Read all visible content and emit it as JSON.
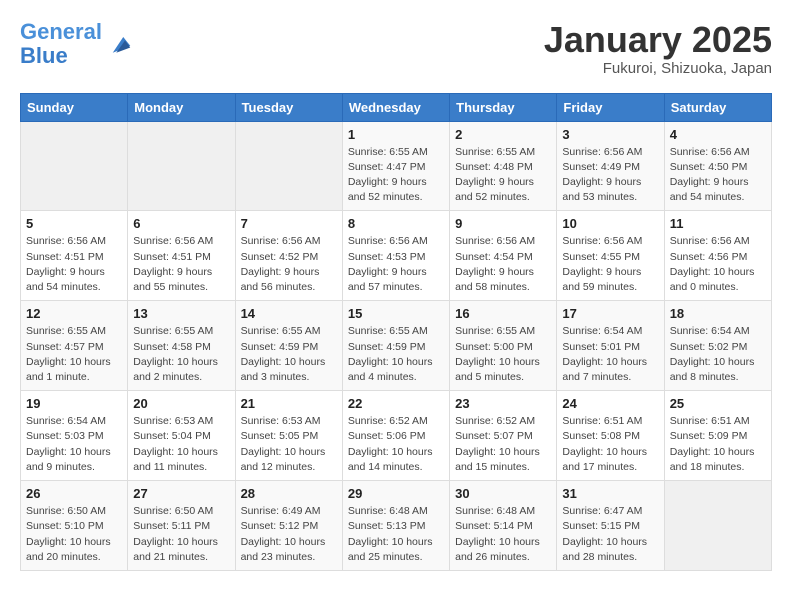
{
  "header": {
    "logo_line1": "General",
    "logo_line2": "Blue",
    "month": "January 2025",
    "location": "Fukuroi, Shizuoka, Japan"
  },
  "weekdays": [
    "Sunday",
    "Monday",
    "Tuesday",
    "Wednesday",
    "Thursday",
    "Friday",
    "Saturday"
  ],
  "weeks": [
    [
      {
        "day": "",
        "info": ""
      },
      {
        "day": "",
        "info": ""
      },
      {
        "day": "",
        "info": ""
      },
      {
        "day": "1",
        "info": "Sunrise: 6:55 AM\nSunset: 4:47 PM\nDaylight: 9 hours and 52 minutes."
      },
      {
        "day": "2",
        "info": "Sunrise: 6:55 AM\nSunset: 4:48 PM\nDaylight: 9 hours and 52 minutes."
      },
      {
        "day": "3",
        "info": "Sunrise: 6:56 AM\nSunset: 4:49 PM\nDaylight: 9 hours and 53 minutes."
      },
      {
        "day": "4",
        "info": "Sunrise: 6:56 AM\nSunset: 4:50 PM\nDaylight: 9 hours and 54 minutes."
      }
    ],
    [
      {
        "day": "5",
        "info": "Sunrise: 6:56 AM\nSunset: 4:51 PM\nDaylight: 9 hours and 54 minutes."
      },
      {
        "day": "6",
        "info": "Sunrise: 6:56 AM\nSunset: 4:51 PM\nDaylight: 9 hours and 55 minutes."
      },
      {
        "day": "7",
        "info": "Sunrise: 6:56 AM\nSunset: 4:52 PM\nDaylight: 9 hours and 56 minutes."
      },
      {
        "day": "8",
        "info": "Sunrise: 6:56 AM\nSunset: 4:53 PM\nDaylight: 9 hours and 57 minutes."
      },
      {
        "day": "9",
        "info": "Sunrise: 6:56 AM\nSunset: 4:54 PM\nDaylight: 9 hours and 58 minutes."
      },
      {
        "day": "10",
        "info": "Sunrise: 6:56 AM\nSunset: 4:55 PM\nDaylight: 9 hours and 59 minutes."
      },
      {
        "day": "11",
        "info": "Sunrise: 6:56 AM\nSunset: 4:56 PM\nDaylight: 10 hours and 0 minutes."
      }
    ],
    [
      {
        "day": "12",
        "info": "Sunrise: 6:55 AM\nSunset: 4:57 PM\nDaylight: 10 hours and 1 minute."
      },
      {
        "day": "13",
        "info": "Sunrise: 6:55 AM\nSunset: 4:58 PM\nDaylight: 10 hours and 2 minutes."
      },
      {
        "day": "14",
        "info": "Sunrise: 6:55 AM\nSunset: 4:59 PM\nDaylight: 10 hours and 3 minutes."
      },
      {
        "day": "15",
        "info": "Sunrise: 6:55 AM\nSunset: 4:59 PM\nDaylight: 10 hours and 4 minutes."
      },
      {
        "day": "16",
        "info": "Sunrise: 6:55 AM\nSunset: 5:00 PM\nDaylight: 10 hours and 5 minutes."
      },
      {
        "day": "17",
        "info": "Sunrise: 6:54 AM\nSunset: 5:01 PM\nDaylight: 10 hours and 7 minutes."
      },
      {
        "day": "18",
        "info": "Sunrise: 6:54 AM\nSunset: 5:02 PM\nDaylight: 10 hours and 8 minutes."
      }
    ],
    [
      {
        "day": "19",
        "info": "Sunrise: 6:54 AM\nSunset: 5:03 PM\nDaylight: 10 hours and 9 minutes."
      },
      {
        "day": "20",
        "info": "Sunrise: 6:53 AM\nSunset: 5:04 PM\nDaylight: 10 hours and 11 minutes."
      },
      {
        "day": "21",
        "info": "Sunrise: 6:53 AM\nSunset: 5:05 PM\nDaylight: 10 hours and 12 minutes."
      },
      {
        "day": "22",
        "info": "Sunrise: 6:52 AM\nSunset: 5:06 PM\nDaylight: 10 hours and 14 minutes."
      },
      {
        "day": "23",
        "info": "Sunrise: 6:52 AM\nSunset: 5:07 PM\nDaylight: 10 hours and 15 minutes."
      },
      {
        "day": "24",
        "info": "Sunrise: 6:51 AM\nSunset: 5:08 PM\nDaylight: 10 hours and 17 minutes."
      },
      {
        "day": "25",
        "info": "Sunrise: 6:51 AM\nSunset: 5:09 PM\nDaylight: 10 hours and 18 minutes."
      }
    ],
    [
      {
        "day": "26",
        "info": "Sunrise: 6:50 AM\nSunset: 5:10 PM\nDaylight: 10 hours and 20 minutes."
      },
      {
        "day": "27",
        "info": "Sunrise: 6:50 AM\nSunset: 5:11 PM\nDaylight: 10 hours and 21 minutes."
      },
      {
        "day": "28",
        "info": "Sunrise: 6:49 AM\nSunset: 5:12 PM\nDaylight: 10 hours and 23 minutes."
      },
      {
        "day": "29",
        "info": "Sunrise: 6:48 AM\nSunset: 5:13 PM\nDaylight: 10 hours and 25 minutes."
      },
      {
        "day": "30",
        "info": "Sunrise: 6:48 AM\nSunset: 5:14 PM\nDaylight: 10 hours and 26 minutes."
      },
      {
        "day": "31",
        "info": "Sunrise: 6:47 AM\nSunset: 5:15 PM\nDaylight: 10 hours and 28 minutes."
      },
      {
        "day": "",
        "info": ""
      }
    ]
  ]
}
